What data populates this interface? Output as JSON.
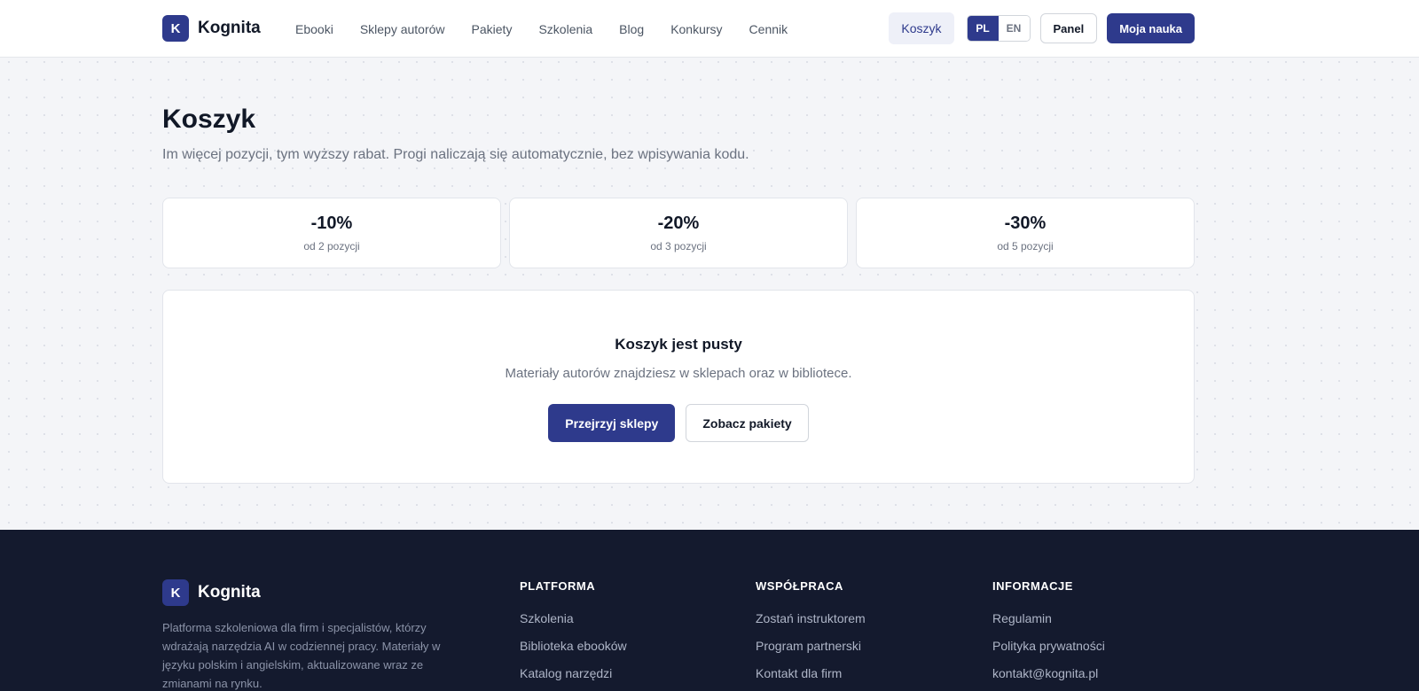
{
  "header": {
    "logo_letter": "K",
    "brand": "Kognita",
    "nav": [
      "Ebooki",
      "Sklepy autorów",
      "Pakiety",
      "Szkolenia",
      "Blog",
      "Konkursy",
      "Cennik"
    ],
    "cart_label": "Koszyk",
    "lang_active": "PL",
    "lang_other": "EN",
    "panel_label": "Panel",
    "learn_label": "Moja nauka"
  },
  "main": {
    "title": "Koszyk",
    "subtitle": "Im więcej pozycji, tym wyższy rabat. Progi naliczają się automatycznie, bez wpisywania kodu.",
    "tiers": [
      {
        "value": "-10%",
        "label": "od 2 pozycji"
      },
      {
        "value": "-20%",
        "label": "od 3 pozycji"
      },
      {
        "value": "-30%",
        "label": "od 5 pozycji"
      }
    ],
    "empty": {
      "title": "Koszyk jest pusty",
      "text": "Materiały autorów znajdziesz w sklepach oraz w bibliotece.",
      "primary": "Przejrzyj sklepy",
      "secondary": "Zobacz pakiety"
    }
  },
  "footer": {
    "logo_letter": "K",
    "brand": "Kognita",
    "description": "Platforma szkoleniowa dla firm i specjalistów, którzy wdrażają narzędzia AI w codziennej pracy. Materiały w języku polskim i angielskim, aktualizowane wraz ze zmianami na rynku.",
    "columns": [
      {
        "heading": "PLATFORMA",
        "links": [
          "Szkolenia",
          "Biblioteka ebooków",
          "Katalog narzędzi"
        ]
      },
      {
        "heading": "WSPÓŁPRACA",
        "links": [
          "Zostań instruktorem",
          "Program partnerski",
          "Kontakt dla firm"
        ]
      },
      {
        "heading": "INFORMACJE",
        "links": [
          "Regulamin",
          "Polityka prywatności",
          "kontakt@kognita.pl"
        ]
      }
    ]
  },
  "colors": {
    "accent": "#2e3a8c",
    "footer_bg": "#141a2e",
    "page_bg": "#f4f5f8"
  }
}
